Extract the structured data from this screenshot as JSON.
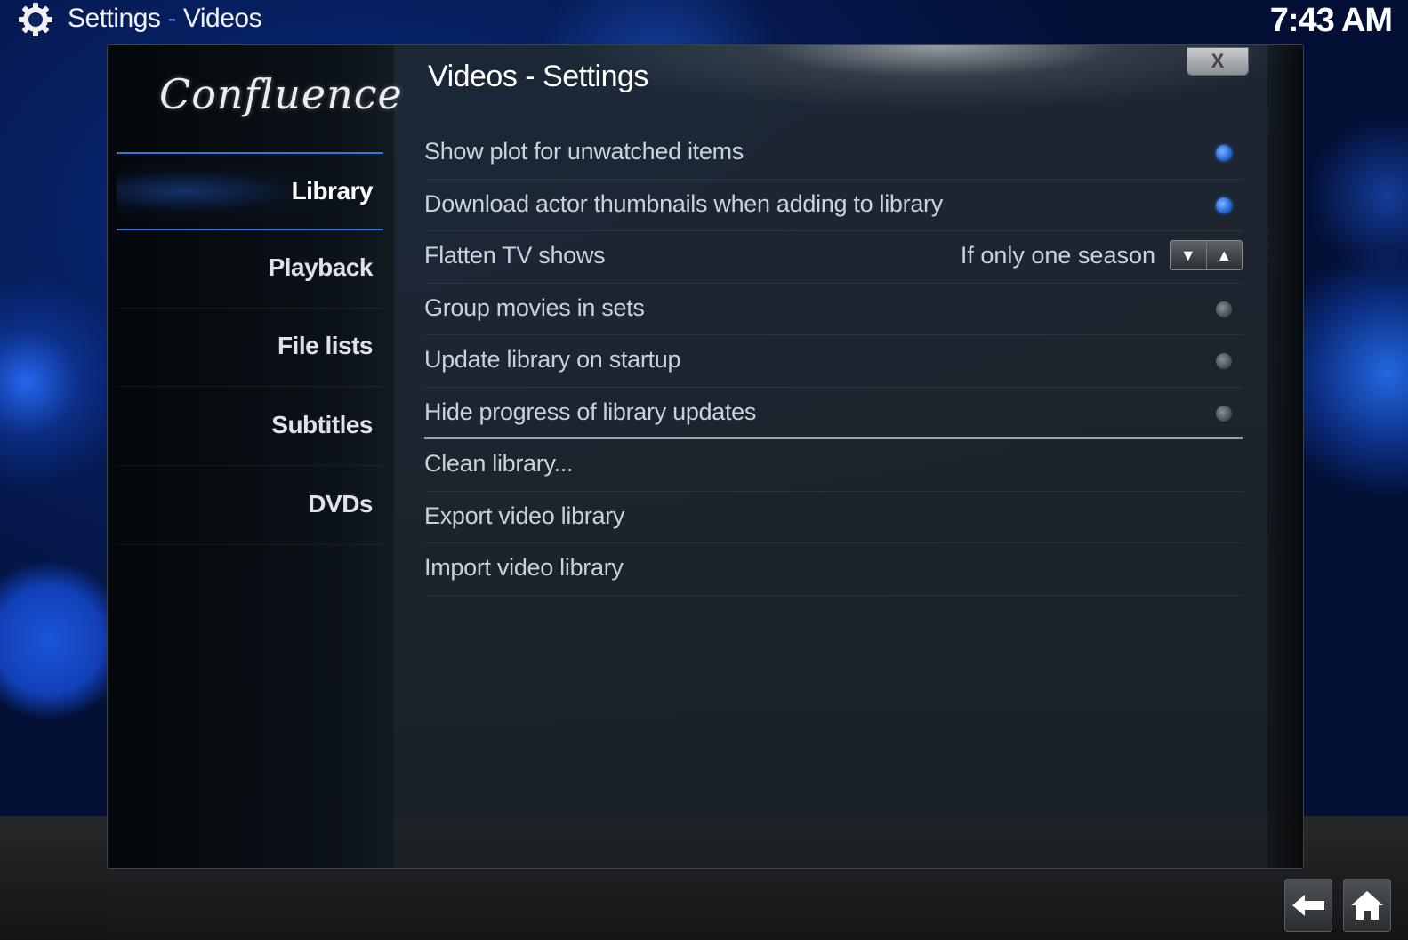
{
  "topbar": {
    "section": "Settings",
    "separator": "-",
    "subsection": "Videos",
    "clock": "7:43 AM"
  },
  "window": {
    "logo": "Confluence",
    "title": "Videos - Settings",
    "close_label": "X"
  },
  "sidebar": {
    "items": [
      {
        "label": "Library",
        "active": true
      },
      {
        "label": "Playback",
        "active": false
      },
      {
        "label": "File lists",
        "active": false
      },
      {
        "label": "Subtitles",
        "active": false
      },
      {
        "label": "DVDs",
        "active": false
      }
    ]
  },
  "settings": [
    {
      "label": "Show plot for unwatched items",
      "type": "radio",
      "checked": true
    },
    {
      "label": "Download actor thumbnails when adding to library",
      "type": "radio",
      "checked": true
    },
    {
      "label": "Flatten TV shows",
      "type": "spinner",
      "value": "If only one season"
    },
    {
      "label": "Group movies in sets",
      "type": "radio",
      "checked": false
    },
    {
      "label": "Update library on startup",
      "type": "radio",
      "checked": false
    },
    {
      "label": "Hide progress of library updates",
      "type": "radio",
      "checked": false
    },
    {
      "label": "Clean library...",
      "type": "action"
    },
    {
      "label": "Export video library",
      "type": "action"
    },
    {
      "label": "Import video library",
      "type": "action"
    }
  ],
  "icons": {
    "settings": "gear-icon",
    "spin_down": "▼",
    "spin_up": "▲",
    "back": "back-arrow-icon",
    "home": "home-icon"
  },
  "colors": {
    "accent": "#2b79e8",
    "radio_on": "#2a6de0",
    "radio_off": "#4b5157"
  }
}
